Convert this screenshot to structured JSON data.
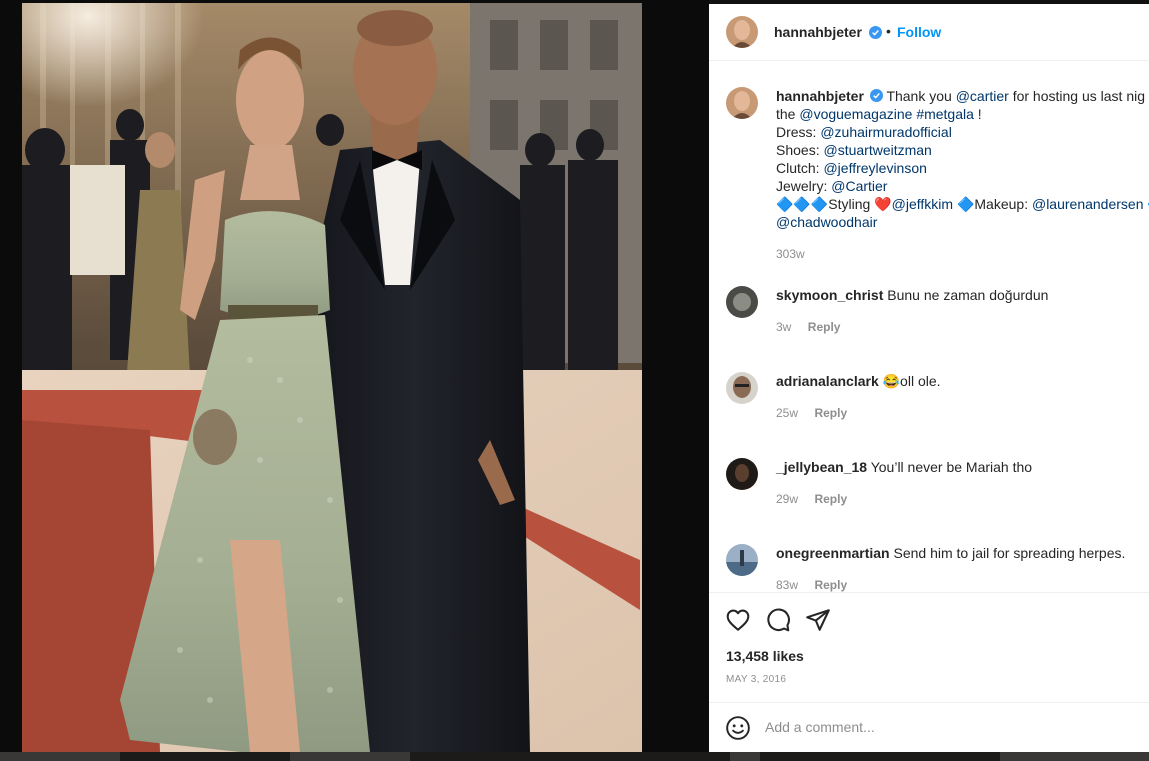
{
  "post": {
    "author": "hannahbjeter",
    "follow_label": "Follow",
    "separator": "•"
  },
  "caption": {
    "author": "hannahbjeter",
    "line1_text": "Thank you",
    "line1_mention": "@cartier",
    "line1_rest": "for hosting us last nig",
    "line2_prefix": "the",
    "line2_mention": "@voguemagazine",
    "line2_tag": "#metgala",
    "line2_suffix": "!",
    "dress_label": "Dress:",
    "dress_mention": "@zuhairmuradofficial",
    "shoes_label": "Shoes:",
    "shoes_mention": "@stuartweitzman",
    "clutch_label": "Clutch:",
    "clutch_mention": "@jeffreylevinson",
    "jewelry_label": "Jewelry:",
    "jewelry_mention": "@Cartier",
    "styling_prefix": "🔷🔷🔷Styling ❤️",
    "styling_mention": "@jeffkkim",
    "makeup_prefix": "🔷Makeup:",
    "makeup_mention": "@laurenandersen",
    "makeup_suffix": "🔷",
    "hair_mention": "@chadwoodhair",
    "age": "303w"
  },
  "comments": [
    {
      "user": "skymoon_christ",
      "text": "Bunu ne zaman doğurdun",
      "age": "3w",
      "reply": "Reply"
    },
    {
      "user": "adrianalanclark",
      "text": "😂oll ole.",
      "age": "25w",
      "reply": "Reply"
    },
    {
      "user": "_jellybean_18",
      "text": "You’ll never be Mariah tho",
      "age": "29w",
      "reply": "Reply"
    },
    {
      "user": "onegreenmartian",
      "text": "Send him to jail for spreading herpes.",
      "age": "83w",
      "reply": "Reply"
    }
  ],
  "stats": {
    "likes": "13,458 likes",
    "date": "MAY 3, 2016"
  },
  "comment_box": {
    "placeholder": "Add a comment..."
  },
  "icons": {
    "like": "heart-icon",
    "comment": "comment-bubble-icon",
    "share": "paper-plane-icon",
    "emoji": "emoji-icon",
    "verified": "verified-badge-icon"
  },
  "colors": {
    "follow": "#0095f6",
    "link": "#00376b",
    "verified": "#3897f0",
    "muted": "#8e8e8e"
  }
}
